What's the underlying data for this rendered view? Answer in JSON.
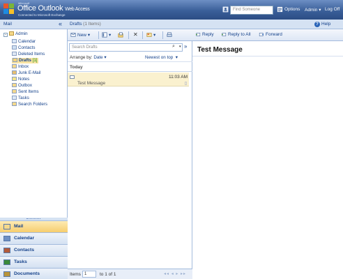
{
  "banner": {
    "brand_prefix": "Microsoft",
    "product": "Office Outlook",
    "product_suffix": "Web Access",
    "subtitle": "Connected to Microsoft Exchange",
    "find_placeholder": "Find Someone",
    "options_label": "Options",
    "user_label": "Admin",
    "logoff_label": "Log Off"
  },
  "subbar": {
    "mail_label": "Mail",
    "collapse_glyph": "«",
    "folder_name": "Drafts",
    "folder_count": "(1 Items)",
    "help_label": "Help"
  },
  "tree": {
    "expander": "-",
    "root": "Admin",
    "items": [
      {
        "label": "Calendar",
        "color": "#d9e6f7"
      },
      {
        "label": "Contacts",
        "color": "#cfe0f3"
      },
      {
        "label": "Deleted Items",
        "color": "#dfe7f3"
      },
      {
        "label": "Drafts",
        "count": "[1]",
        "color": "#f3d37a"
      },
      {
        "label": "Inbox",
        "color": "#f5d98b"
      },
      {
        "label": "Junk E-Mail",
        "color": "#e8c070"
      },
      {
        "label": "Notes",
        "color": "#f3e48a"
      },
      {
        "label": "Outbox",
        "color": "#f5d98b"
      },
      {
        "label": "Sent Items",
        "color": "#f5d98b"
      },
      {
        "label": "Tasks",
        "color": "#dde8f6"
      },
      {
        "label": "Search Folders",
        "color": "#f5d98b"
      }
    ]
  },
  "nav": [
    {
      "label": "Mail",
      "active": true
    },
    {
      "label": "Calendar",
      "active": false
    },
    {
      "label": "Contacts",
      "active": false
    },
    {
      "label": "Tasks",
      "active": false
    },
    {
      "label": "Documents",
      "active": false
    }
  ],
  "list_toolbar": {
    "new_label": "New",
    "dropdown_glyph": "▾",
    "delete_glyph": "✕"
  },
  "list": {
    "search_placeholder": "Search Drafts",
    "search_glyph": "⌕",
    "search_dd_glyph": "▾",
    "search_expand_glyph": "»",
    "arrange_label": "Arrange by:",
    "arrange_value": "Date",
    "sort_label": "Newest on top",
    "group_header": "Today",
    "messages": [
      {
        "subject": "Test Message",
        "time": "11:03 AM"
      }
    ]
  },
  "footer": {
    "items_label": "Items",
    "page_value": "1",
    "of_label": "to 1 of 1",
    "pager_glyphs": "◂◂ ◂ ▸ ▸▸"
  },
  "reading": {
    "reply_label": "Reply",
    "reply_all_label": "Reply to All",
    "forward_label": "Forward",
    "title": "Test Message"
  },
  "colors": {
    "banner_top": "#6d8fc4",
    "banner_bottom": "#2c4d84",
    "accent_text": "#15428b",
    "selected_row": "#faf1cf",
    "active_nav": "#f6cd6e"
  }
}
